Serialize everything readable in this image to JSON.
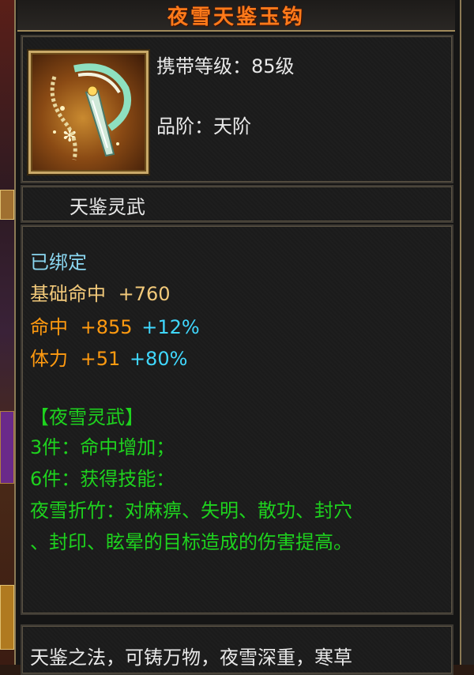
{
  "item": {
    "name": "夜雪天鉴玉钩",
    "carry_level_label": "携带等级：",
    "carry_level_value": "85级",
    "grade_label": "品阶：",
    "grade_value": "天阶",
    "category": "天鉴灵武"
  },
  "stats": {
    "bound": "已绑定",
    "base_hit_label": "基础命中",
    "base_hit_value": "+760",
    "hit_label": "命中",
    "hit_value": "+855",
    "hit_bonus": "+12%",
    "stamina_label": "体力",
    "stamina_value": "+51",
    "stamina_bonus": "+80%"
  },
  "set": {
    "name": "【夜雪灵武】",
    "piece3": "3件：命中增加；",
    "piece6": "6件：获得技能：",
    "skill_line1": "夜雪折竹：对麻痹、失明、散功、封穴",
    "skill_line2": "、封印、眩晕的目标造成的伤害提高。"
  },
  "description": "天鉴之法，可铸万物，夜雪深重，寒草",
  "colors": {
    "title": "#ff7a1a",
    "bound": "#8ad6f0",
    "base_stat": "#f2c97a",
    "stat": "#ff9a10",
    "bonus": "#40d8ff",
    "set": "#1ed21e"
  }
}
